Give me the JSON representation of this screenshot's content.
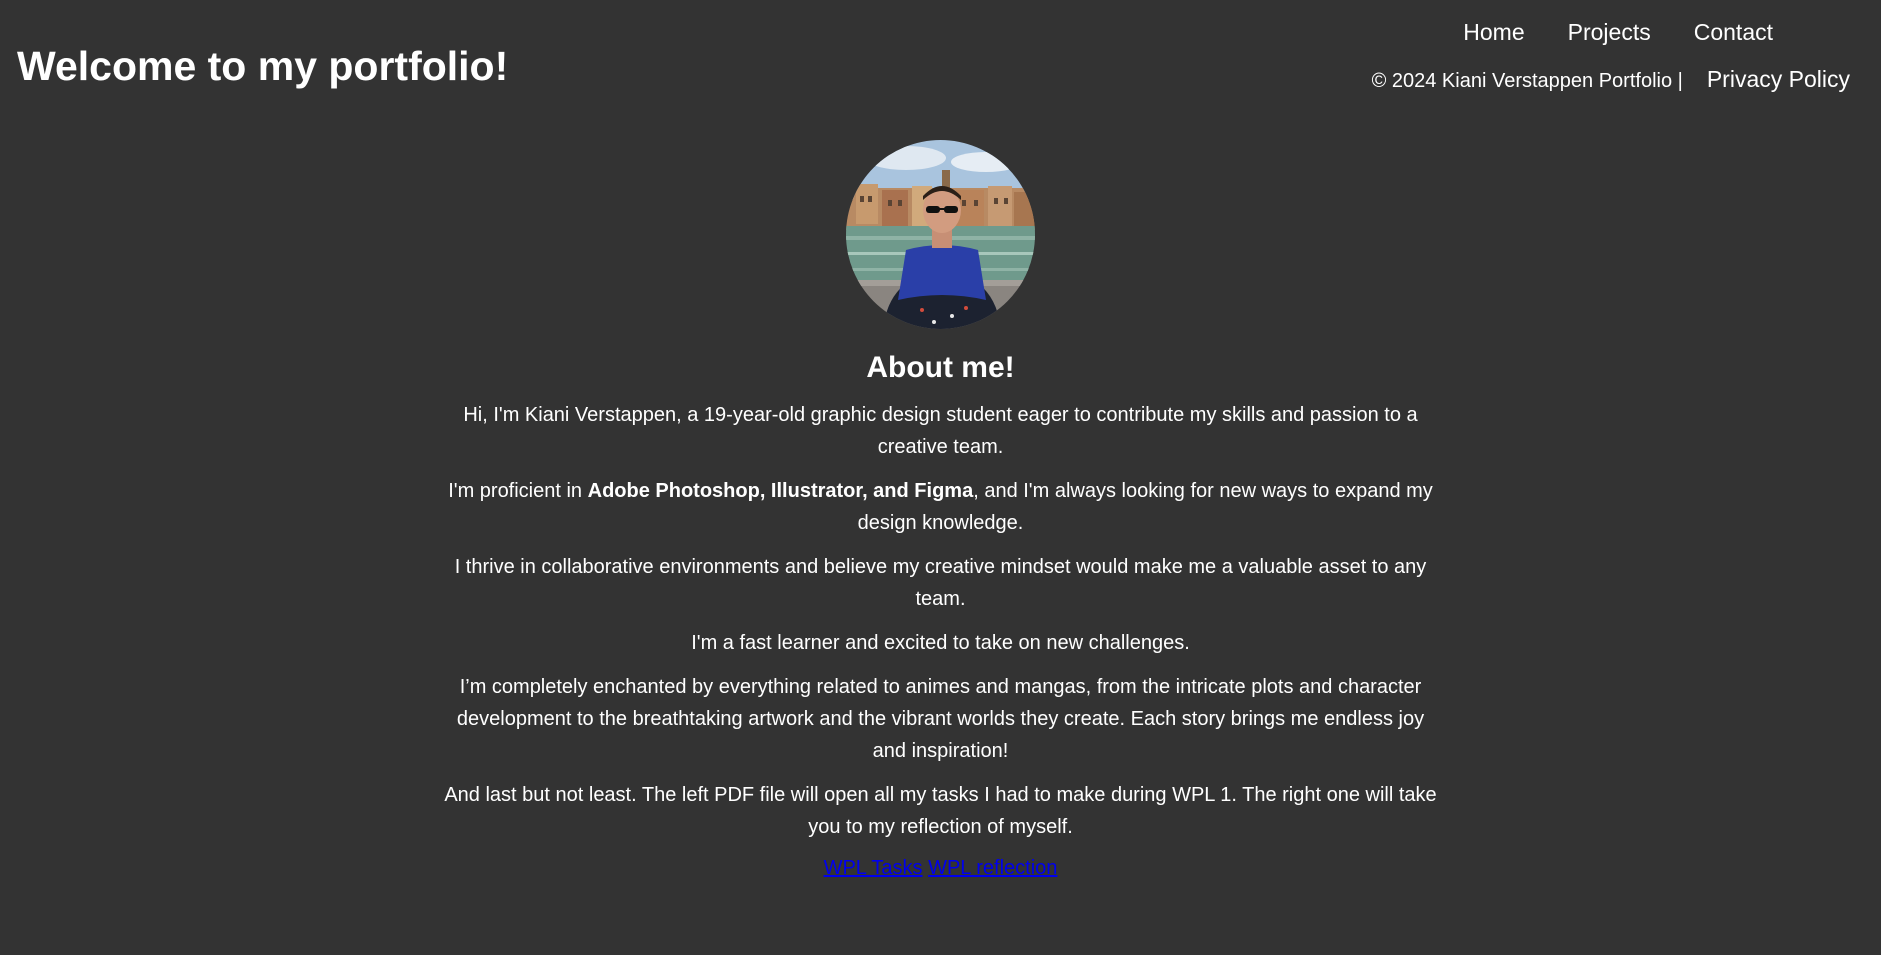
{
  "header": {
    "title": "Welcome to my portfolio!",
    "nav": [
      {
        "label": "Home"
      },
      {
        "label": "Projects"
      },
      {
        "label": "Contact"
      }
    ],
    "copyright": "© 2024 Kiani Verstappen Portfolio |",
    "privacy_label": "Privacy Policy"
  },
  "about": {
    "heading": "About me!",
    "p1": "Hi, I'm Kiani Verstappen, a 19-year-old graphic design student eager to contribute my skills and passion to a creative team.",
    "p2_before": "I'm proficient in ",
    "p2_bold": "Adobe Photoshop, Illustrator, and Figma",
    "p2_after": ", and I'm always looking for new ways to expand my design knowledge.",
    "p3": "I thrive in collaborative environments and believe my creative mindset would make me a valuable asset to any team.",
    "p4": "I'm a fast learner and excited to take on new challenges.",
    "p5": "I’m completely enchanted by everything related to animes and mangas, from the intricate plots and character development to the breathtaking artwork and the vibrant worlds they create. Each story brings me endless joy and inspiration!",
    "p6": "And last but not least. The left PDF file will open all my tasks I had to make during WPL 1. The right one will take you to my reflection of myself.",
    "links": [
      {
        "label": "WPL Tasks"
      },
      {
        "label": "WPL reflection"
      }
    ]
  },
  "colors": {
    "background": "#333333",
    "text": "#ffffff",
    "link": "#0000ee"
  }
}
